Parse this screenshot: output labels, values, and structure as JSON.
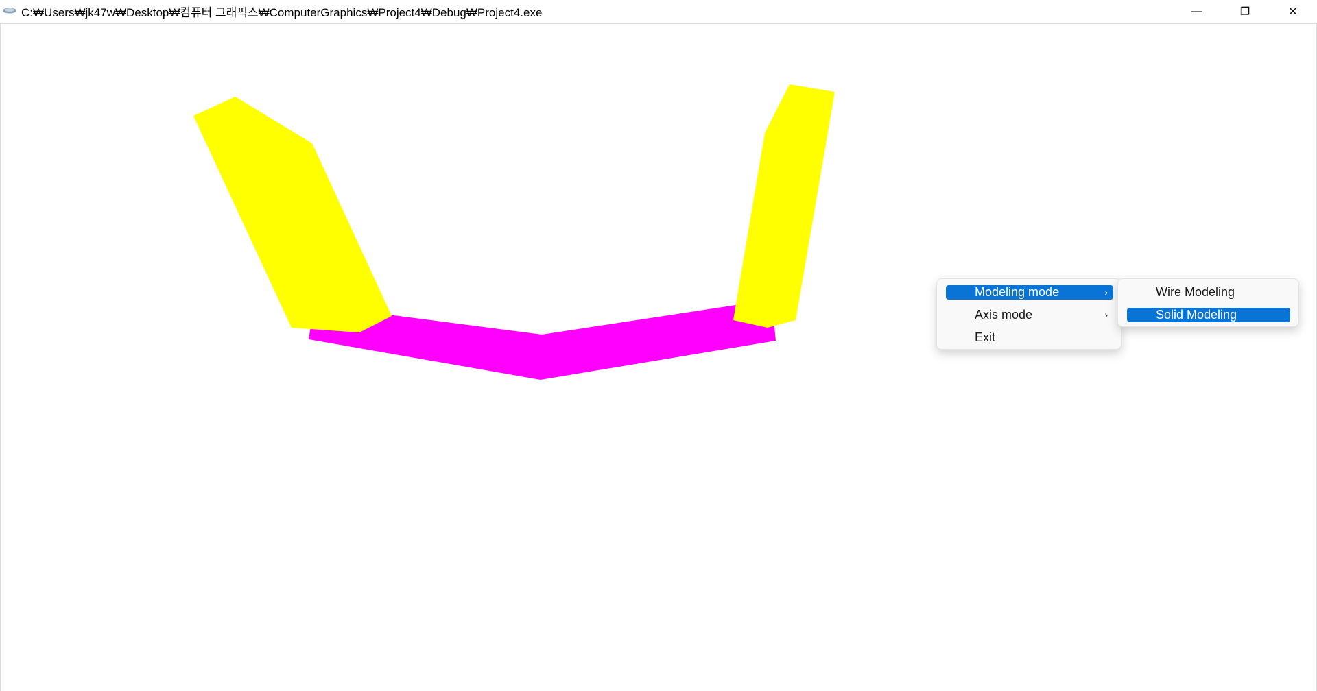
{
  "window": {
    "title": "C:₩Users₩jk47w₩Desktop₩컴퓨터 그래픽스₩ComputerGraphics₩Project4₩Debug₩Project4.exe",
    "app_icon": "app-icon",
    "controls": {
      "minimize_glyph": "—",
      "restore_glyph": "❐",
      "close_glyph": "✕"
    }
  },
  "scene": {
    "colors": {
      "arm": "#ffff00",
      "base": "#ff00ff",
      "background": "#ffffff"
    }
  },
  "context_menu": {
    "items": [
      {
        "label": "Modeling mode",
        "has_submenu": true,
        "highlighted": true
      },
      {
        "label": "Axis mode",
        "has_submenu": true,
        "highlighted": false
      },
      {
        "label": "Exit",
        "has_submenu": false,
        "highlighted": false
      }
    ],
    "submenu": {
      "items": [
        {
          "label": "Wire Modeling",
          "highlighted": false
        },
        {
          "label": "Solid Modeling",
          "highlighted": true
        }
      ]
    },
    "chevron_glyph": "›",
    "highlight_color": "#0a74d6"
  }
}
